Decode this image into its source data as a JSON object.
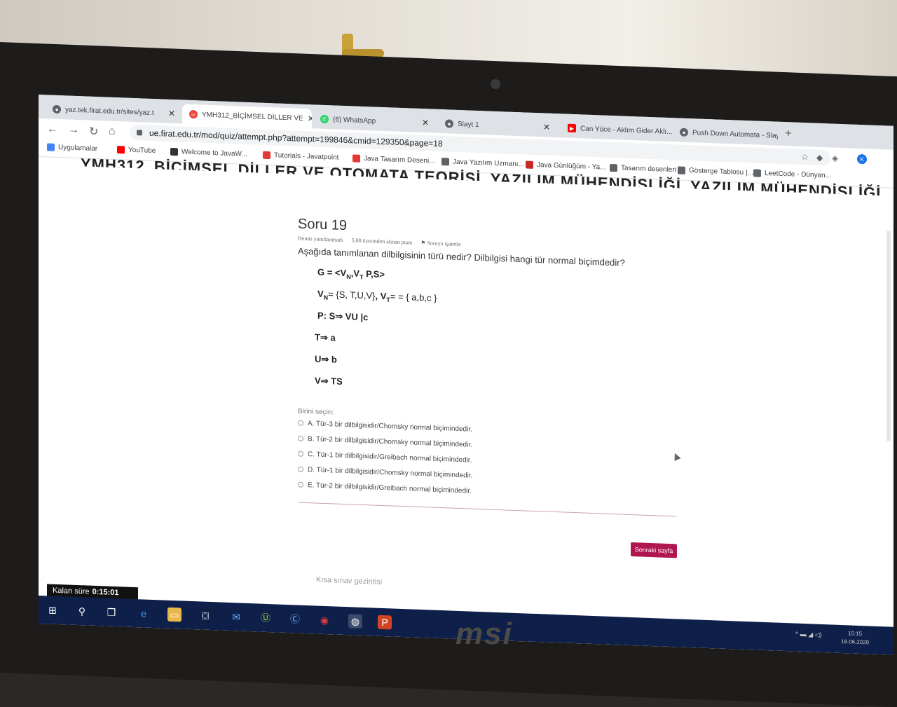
{
  "tabs": [
    {
      "label": "yaz.tek.firat.edu.tr/sites/yaz.t",
      "color": "#5f6368"
    },
    {
      "label": "YMH312_BİÇİMSEL DİLLER VE",
      "color": "#e8453c"
    },
    {
      "label": "(6) WhatsApp",
      "color": "#25d366"
    },
    {
      "label": "Slayt 1",
      "color": "#5f6368"
    },
    {
      "label": "Can Yüce - Aklım Gider Aklı...",
      "color": "#ff0000"
    },
    {
      "label": "Push Down Automata - Slay...",
      "color": "#5f6368"
    }
  ],
  "address_bar": {
    "url": "ue.firat.edu.tr/mod/quiz/attempt.php?attempt=199846&cmid=129350&page=18"
  },
  "bookmarks": [
    {
      "label": "Uygulamalar",
      "color": "#4285f4"
    },
    {
      "label": "YouTube",
      "color": "#ff0000"
    },
    {
      "label": "Welcome to JavaW...",
      "color": "#333333"
    },
    {
      "label": "Tutorials - Javatpoint",
      "color": "#e53935"
    },
    {
      "label": "Java Tasarım Deseni...",
      "color": "#e53935"
    },
    {
      "label": "Java Yazılım Uzmanı...",
      "color": "#5f6368"
    },
    {
      "label": "Java Günlüğüm - Ya...",
      "color": "#c62828"
    },
    {
      "label": "Tasarım desenleri",
      "color": "#5f6368"
    },
    {
      "label": "Gösterge Tablosu |...",
      "color": "#5f6368"
    },
    {
      "label": "LeetCode - Dünyan...",
      "color": "#5f6368"
    }
  ],
  "course_title": "YMH312_BİÇİMSEL DİLLER VE OTOMATA TEORİSİ_YAZILIM MÜHENDİSLİĞİ_YAZILIM MÜHENDİSLİĞİ",
  "question": {
    "title": "Soru 19",
    "status": "Henüz yanıtlanmadı",
    "points": "5,00 üzerinden alınan puan",
    "flag": "Soruyu işaretle",
    "text": "Aşağıda tanımlanan dilbilgisinin türü nedir? Dilbilgisi hangi tür normal biçimdedir?",
    "formula": {
      "g_prefix": "G = <V",
      "g_sub1": "N",
      "g_mid": ",V",
      "g_sub2": "T",
      "g_suffix": " P,S>",
      "vn_prefix": "V",
      "vn_sub": "N",
      "vn_set": "= {S, T,U,V}",
      "vt_prefix": ", V",
      "vt_sub": "T",
      "vt_set": "= = { a,b,c }",
      "p_rule": "P:  S⇒ VU |c",
      "rule_t": "T⇒ a",
      "rule_u": "U⇒ b",
      "rule_v": "V⇒ TS"
    },
    "select_label": "Birini seçin:",
    "options": [
      "A. Tür-3 bir dilbilgisidir/Chomsky normal biçimindedir.",
      "B. Tür-2 bir dilbilgisidir/Chomsky normal biçimindedir.",
      "C. Tür-1 bir dilbilgisidir/Greibach normal biçimindedir.",
      "D. Tür-1 bir dilbilgisidir/Chomsky normal biçimindedir.",
      "E. Tür-2 bir dilbilgisidir/Greibach normal biçimindedir."
    ],
    "next_button": "Sonraki sayfa",
    "quick_nav": "Kısa sınav gezintisi"
  },
  "timer": {
    "label": "Kalan süre",
    "value": "0:15:01"
  },
  "clock": {
    "time": "15:15",
    "date": "18.06.2020"
  },
  "brand": "msi",
  "accent_color": "#b0164f"
}
